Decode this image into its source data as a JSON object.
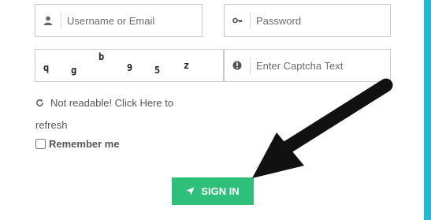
{
  "login_form": {
    "username_placeholder": "Username or Email",
    "password_placeholder": "Password",
    "captcha_placeholder": "Enter Captcha Text",
    "captcha_chars": [
      "q",
      "g",
      "b",
      "9",
      "5",
      "z"
    ],
    "refresh_text_line1": "Not readable! Click Here to",
    "refresh_text_line2": "refresh",
    "remember_label": "Remember me",
    "signin_label": "SIGN IN"
  },
  "colors": {
    "signin_button": "#2ec07a",
    "accent_band": "#1fb8d8",
    "arrow": "#111111"
  },
  "icons": {
    "username": "user-icon",
    "password": "key-icon",
    "captcha_info": "info-circle-icon",
    "refresh": "refresh-icon",
    "signin": "location-arrow-icon"
  }
}
